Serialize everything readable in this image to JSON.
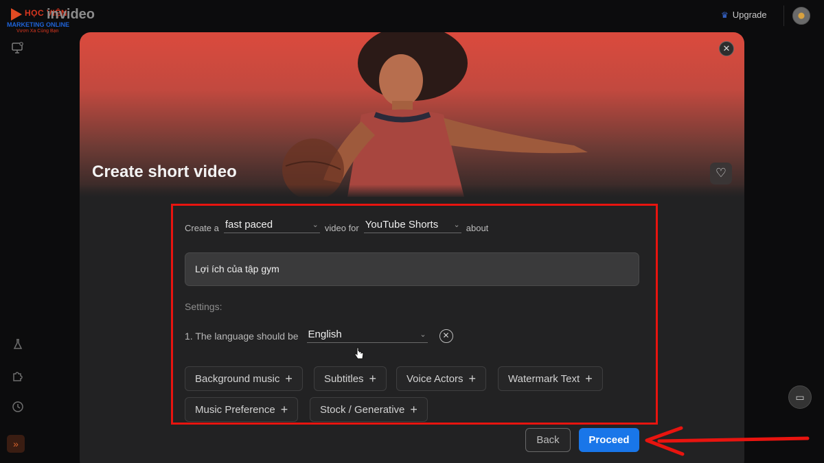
{
  "watermark": {
    "line1": "HỌC VIỆN",
    "line2": "MARKETING ONLINE",
    "line3": "Vươn Xa Cùng Bạn"
  },
  "app": {
    "logo_text": "invideo",
    "upgrade_label": "Upgrade"
  },
  "modal": {
    "title": "Create short video",
    "close_icon": "close-icon",
    "favorite_icon": "heart-icon"
  },
  "form": {
    "create_a": "Create a",
    "pace_value": "fast paced",
    "video_for": "video for",
    "platform_value": "YouTube Shorts",
    "about": "about",
    "prompt_value": "Lợi ích của tập gym",
    "settings_label": "Settings:",
    "language_label": "1. The language should be",
    "language_value": "English",
    "chips": [
      "Background music",
      "Subtitles",
      "Voice Actors",
      "Watermark Text",
      "Music Preference",
      "Stock / Generative"
    ]
  },
  "actions": {
    "back_label": "Back",
    "proceed_label": "Proceed"
  },
  "colors": {
    "accent": "#1976e9",
    "highlight": "#e8140f",
    "hero_top": "#db4a3d"
  }
}
